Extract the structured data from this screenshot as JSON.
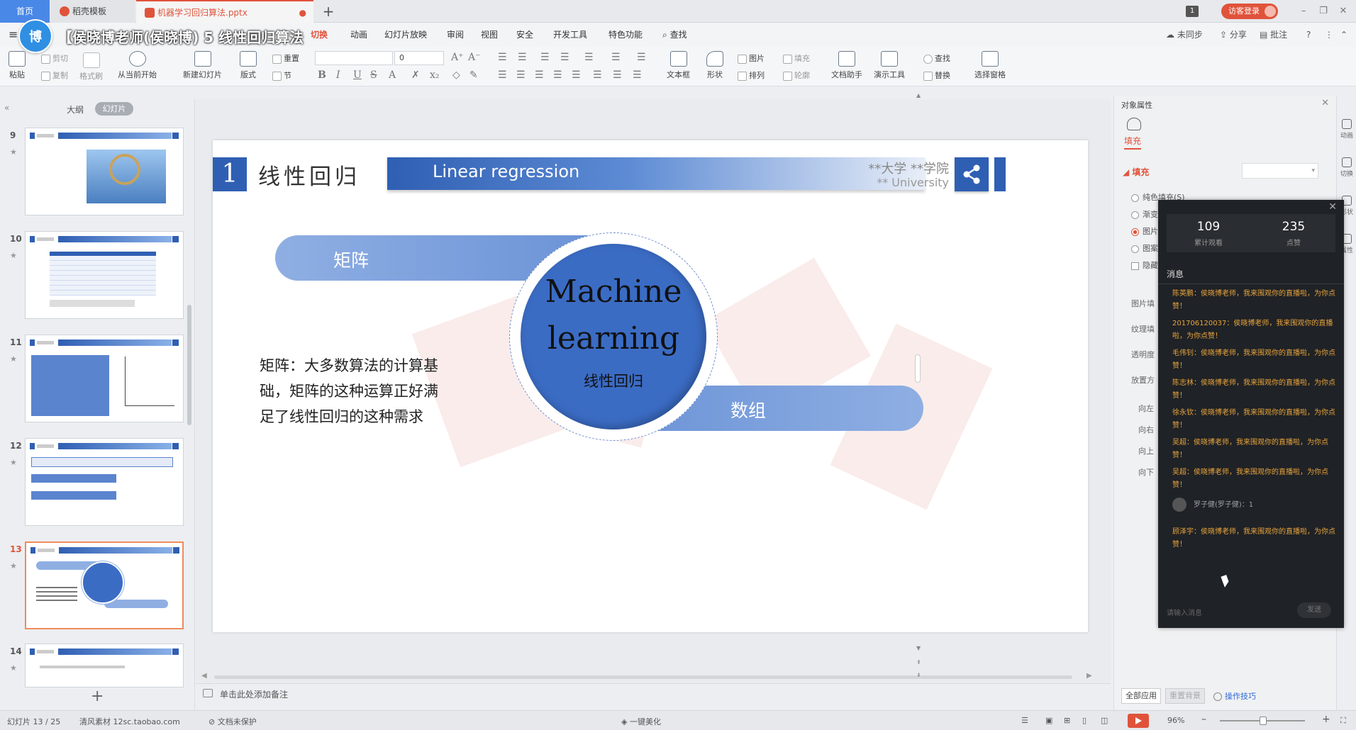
{
  "tabs": {
    "home": "首页",
    "template": "稻壳模板",
    "document": "机器学习回归算法.pptx"
  },
  "window": {
    "login": "访客登录",
    "badge": "1"
  },
  "overlay": {
    "logo": "博",
    "title": "【侯晓博老师(侯晓博) 5 线性回归算法"
  },
  "menu": {
    "items": [
      "切换",
      "动画",
      "幻灯片放映",
      "审阅",
      "视图",
      "安全",
      "开发工具",
      "特色功能",
      "查找"
    ],
    "active": "切换",
    "right": {
      "sync": "未同步",
      "share": "分享",
      "comment": "批注"
    }
  },
  "ribbon": {
    "paste": "粘贴",
    "cut": "剪切",
    "copy": "复制",
    "format_painter": "格式刷",
    "from_current": "从当前开始",
    "new_slide": "新建幻灯片",
    "layout": "版式",
    "reset": "重置",
    "section": "节",
    "font_size": "0",
    "textbox": "文本框",
    "shape": "形状",
    "picture": "图片",
    "fill": "填充",
    "arrange": "排列",
    "outline": "轮廓",
    "doc_helper": "文档助手",
    "present_tool": "演示工具",
    "find": "查找",
    "replace": "替换",
    "select_pane": "选择窗格"
  },
  "left_panel": {
    "outline_tab": "大纲",
    "slides_tab": "幻灯片",
    "slide_numbers": [
      "9",
      "10",
      "11",
      "12",
      "13",
      "14"
    ],
    "active_slide": "13"
  },
  "slide": {
    "number": "1",
    "title": "线性回归",
    "banner": "Linear regression",
    "uni_cn": "**大学 **学院",
    "uni_en": "** University",
    "pill_left": "矩阵",
    "pill_right": "数组",
    "circle_line1": "Machine",
    "circle_line2": "learning",
    "circle_sub": "线性回归",
    "body_lines": [
      "矩阵：大多数算法的计算基",
      "础，矩阵的这种运算正好满",
      "足了线性回归的这种需求"
    ]
  },
  "notes": {
    "placeholder": "单击此处添加备注"
  },
  "right_panel": {
    "title": "对象属性",
    "fill_tab": "填充",
    "fill_section": "填充",
    "options": [
      "纯色填充(S)",
      "渐变",
      "图片",
      "图案",
      "隐藏"
    ],
    "labels": [
      "图片填",
      "纹理填",
      "透明度",
      "放置方",
      "向左",
      "向右",
      "向上",
      "向下"
    ],
    "apply_all": "全部应用",
    "reset_bg": "重置背景",
    "tips": "操作技巧"
  },
  "right_side": {
    "items": [
      "动画",
      "切换",
      "形状",
      "属性"
    ]
  },
  "live": {
    "viewers": "109",
    "viewers_label": "累计观看",
    "likes": "235",
    "likes_label": "点赞",
    "messages_title": "消息",
    "messages": [
      {
        "text": "陈英鹏：侯晓博老师，我来围观你的直播啦，为你点赞！",
        "type": "sys"
      },
      {
        "text": "201706120037：侯晓博老师，我来围观你的直播啦，为你点赞！",
        "type": "sys"
      },
      {
        "text": "毛伟钊：侯晓博老师，我来围观你的直播啦，为你点赞！",
        "type": "sys"
      },
      {
        "text": "陈志林：侯晓博老师，我来围观你的直播啦，为你点赞！",
        "type": "sys"
      },
      {
        "text": "徐永钦：侯晓博老师，我来围观你的直播啦，为你点赞！",
        "type": "sys"
      },
      {
        "text": "吴超：侯晓博老师，我来围观你的直播啦，为你点赞！",
        "type": "sys"
      },
      {
        "text": "吴超：侯晓博老师，我来围观你的直播啦，为你点赞！",
        "type": "sys"
      },
      {
        "text": "罗子健(罗子健)：1",
        "type": "user"
      },
      {
        "text": "顾泽宇：侯晓博老师，我来围观你的直播啦，为你点赞！",
        "type": "sys"
      }
    ],
    "input_placeholder": "请输入消息",
    "send": "发送"
  },
  "status": {
    "slide_info": "幻灯片 13 / 25",
    "theme": "清风素材 12sc.taobao.com",
    "protect": "文档未保护",
    "beautify": "一键美化",
    "zoom": "96%"
  }
}
